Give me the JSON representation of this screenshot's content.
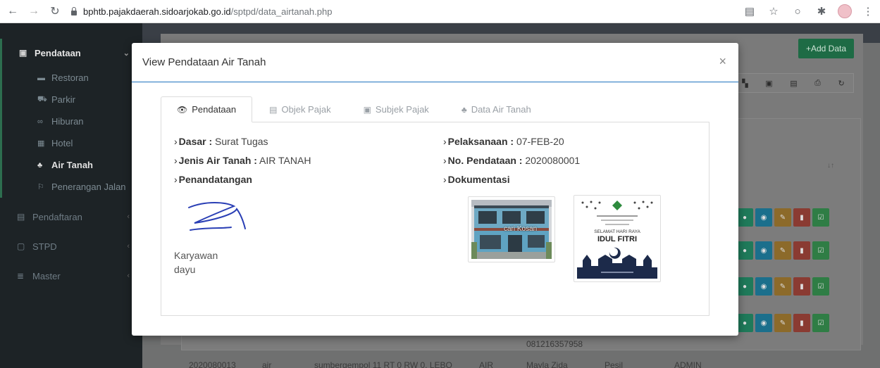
{
  "browser": {
    "url_host": "bphtb.pajakdaerah.sidoarjokab.go.id",
    "url_path": "/sptpd/data_airtanah.php"
  },
  "sidebar": {
    "sections": [
      {
        "label": "Pendataan",
        "items": [
          {
            "label": "Restoran"
          },
          {
            "label": "Parkir"
          },
          {
            "label": "Hiburan"
          },
          {
            "label": "Hotel"
          },
          {
            "label": "Air Tanah"
          },
          {
            "label": "Penerangan Jalan"
          }
        ]
      }
    ],
    "other": [
      {
        "label": "Pendaftaran"
      },
      {
        "label": "STPD"
      },
      {
        "label": "Master"
      }
    ]
  },
  "background": {
    "add_button": "+Add Data",
    "sort_mark": "↓↑",
    "phone": "081216357958",
    "bottom_row": [
      "2020080013",
      "air",
      "sumbergempol 11 RT 0 RW 0, LEBO",
      "AIR",
      "Mayla Zida",
      "Pesil",
      "ADMIN"
    ]
  },
  "modal": {
    "title": "View Pendataan Air Tanah",
    "close": "×",
    "tabs": [
      {
        "label": "Pendataan",
        "icon": "eye-icon"
      },
      {
        "label": "Objek Pajak",
        "icon": "document-icon"
      },
      {
        "label": "Subjek Pajak",
        "icon": "id-card-icon"
      },
      {
        "label": "Data Air Tanah",
        "icon": "sitemap-icon"
      }
    ],
    "fields": {
      "dasar_label": "Dasar :",
      "dasar_value": "Surat Tugas",
      "jenis_label": "Jenis Air Tanah :",
      "jenis_value": "AIR TANAH",
      "penandatangan_label": "Penandatangan",
      "pelaksanaan_label": "Pelaksanaan :",
      "pelaksanaan_value": "07-FEB-20",
      "no_label": "No. Pendataan :",
      "no_value": "2020080001",
      "dokumentasi_label": "Dokumentasi"
    },
    "signer_role": "Karyawan",
    "signer_name": "dayu",
    "greeting_card": {
      "line1": "SELAMAT HARI RAYA",
      "line2": "IDUL FITRI"
    },
    "photo_watermark": "cari Kosan"
  }
}
